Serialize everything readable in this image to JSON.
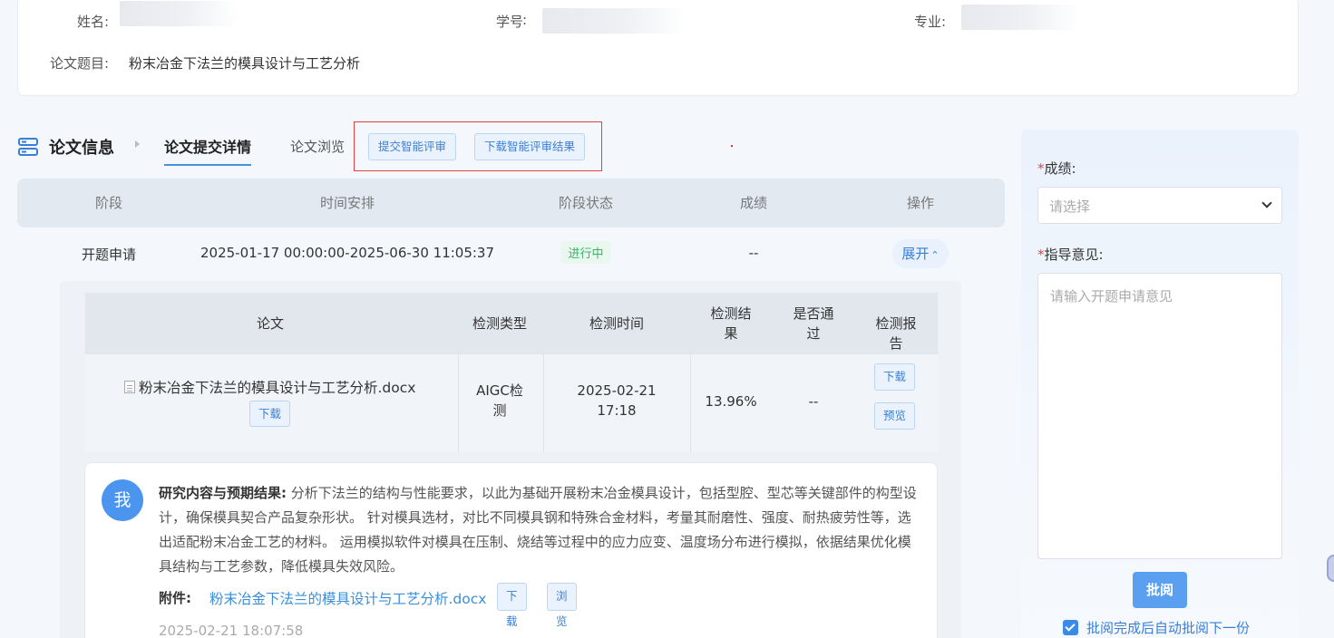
{
  "student": {
    "name_label": "姓名:",
    "student_id_label": "学号",
    "major_label": "专业:",
    "thesis_title_label": "论文题目:",
    "thesis_title": "粉末冶金下法兰的模具设计与工艺分析"
  },
  "tabs": {
    "section_title": "论文信息",
    "active_tab": "论文提交详情",
    "browse_tab": "论文浏览",
    "submit_ai_review": "提交智能评审",
    "download_ai_result": "下载智能评审结果"
  },
  "stage_table": {
    "headers": [
      "阶段",
      "时间安排",
      "阶段状态",
      "成绩",
      "操作"
    ],
    "rows": [
      {
        "stage": "开题申请",
        "schedule": "2025-01-17 00:00:00-2025-06-30 11:05:37",
        "status": "进行中",
        "grade": "--",
        "action": "展开"
      }
    ]
  },
  "detection_table": {
    "headers": [
      "论文",
      "检测类型",
      "检测时间",
      "检测结果",
      "是否通过",
      "检测报告"
    ],
    "header_lines": {
      "result": [
        "检测结",
        "果"
      ],
      "passed": [
        "是否通",
        "过"
      ]
    },
    "rows": [
      {
        "file": "粉末冶金下法兰的模具设计与工艺分析.docx",
        "file_download": "下载",
        "type_lines": [
          "AIGC检",
          "测"
        ],
        "date": "2025-02-21",
        "time": "17:18",
        "result": "13.96%",
        "passed": "--",
        "report_download": "下载",
        "report_preview": "预览"
      }
    ]
  },
  "comment": {
    "avatar_text": "我",
    "heading": "研究内容与预期结果:",
    "body": "分析下法兰的结构与性能要求，以此为基础开展粉末冶金模具设计，包括型腔、型芯等关键部件的构型设计，确保模具契合产品复杂形状。 针对模具选材，对比不同模具钢和特殊合金材料，考量其耐磨性、强度、耐热疲劳性等，选出适配粉末冶金工艺的材料。 运用模拟软件对模具在压制、烧结等过程中的应力应变、温度场分布进行模拟，依据结果优化模具结构与工艺参数，降低模具失效风险。",
    "attachment_label": "附件:",
    "attachment_file": "粉末冶金下法兰的模具设计与工艺分析.docx",
    "download": "下载",
    "browse": "浏览",
    "timestamp": "2025-02-21 18:07:58"
  },
  "review_panel": {
    "required_mark": "*",
    "grade_label": "成绩:",
    "grade_placeholder": "请选择",
    "advice_label": "指导意见:",
    "advice_placeholder": "请输入开题申请意见",
    "submit": "批阅",
    "auto_next": "批阅完成后自动批阅下一份",
    "auto_next_checked": true
  },
  "colors": {
    "accent": "#3a7fd5",
    "primary_button": "#5b9ff0",
    "status_green": "#3bb36a",
    "required_red": "#e04848",
    "highlight_box": "#e04040"
  },
  "icons": [
    "list-icon",
    "doc-file-icon",
    "chevron-up-icon",
    "chevron-down-icon",
    "check-icon"
  ]
}
